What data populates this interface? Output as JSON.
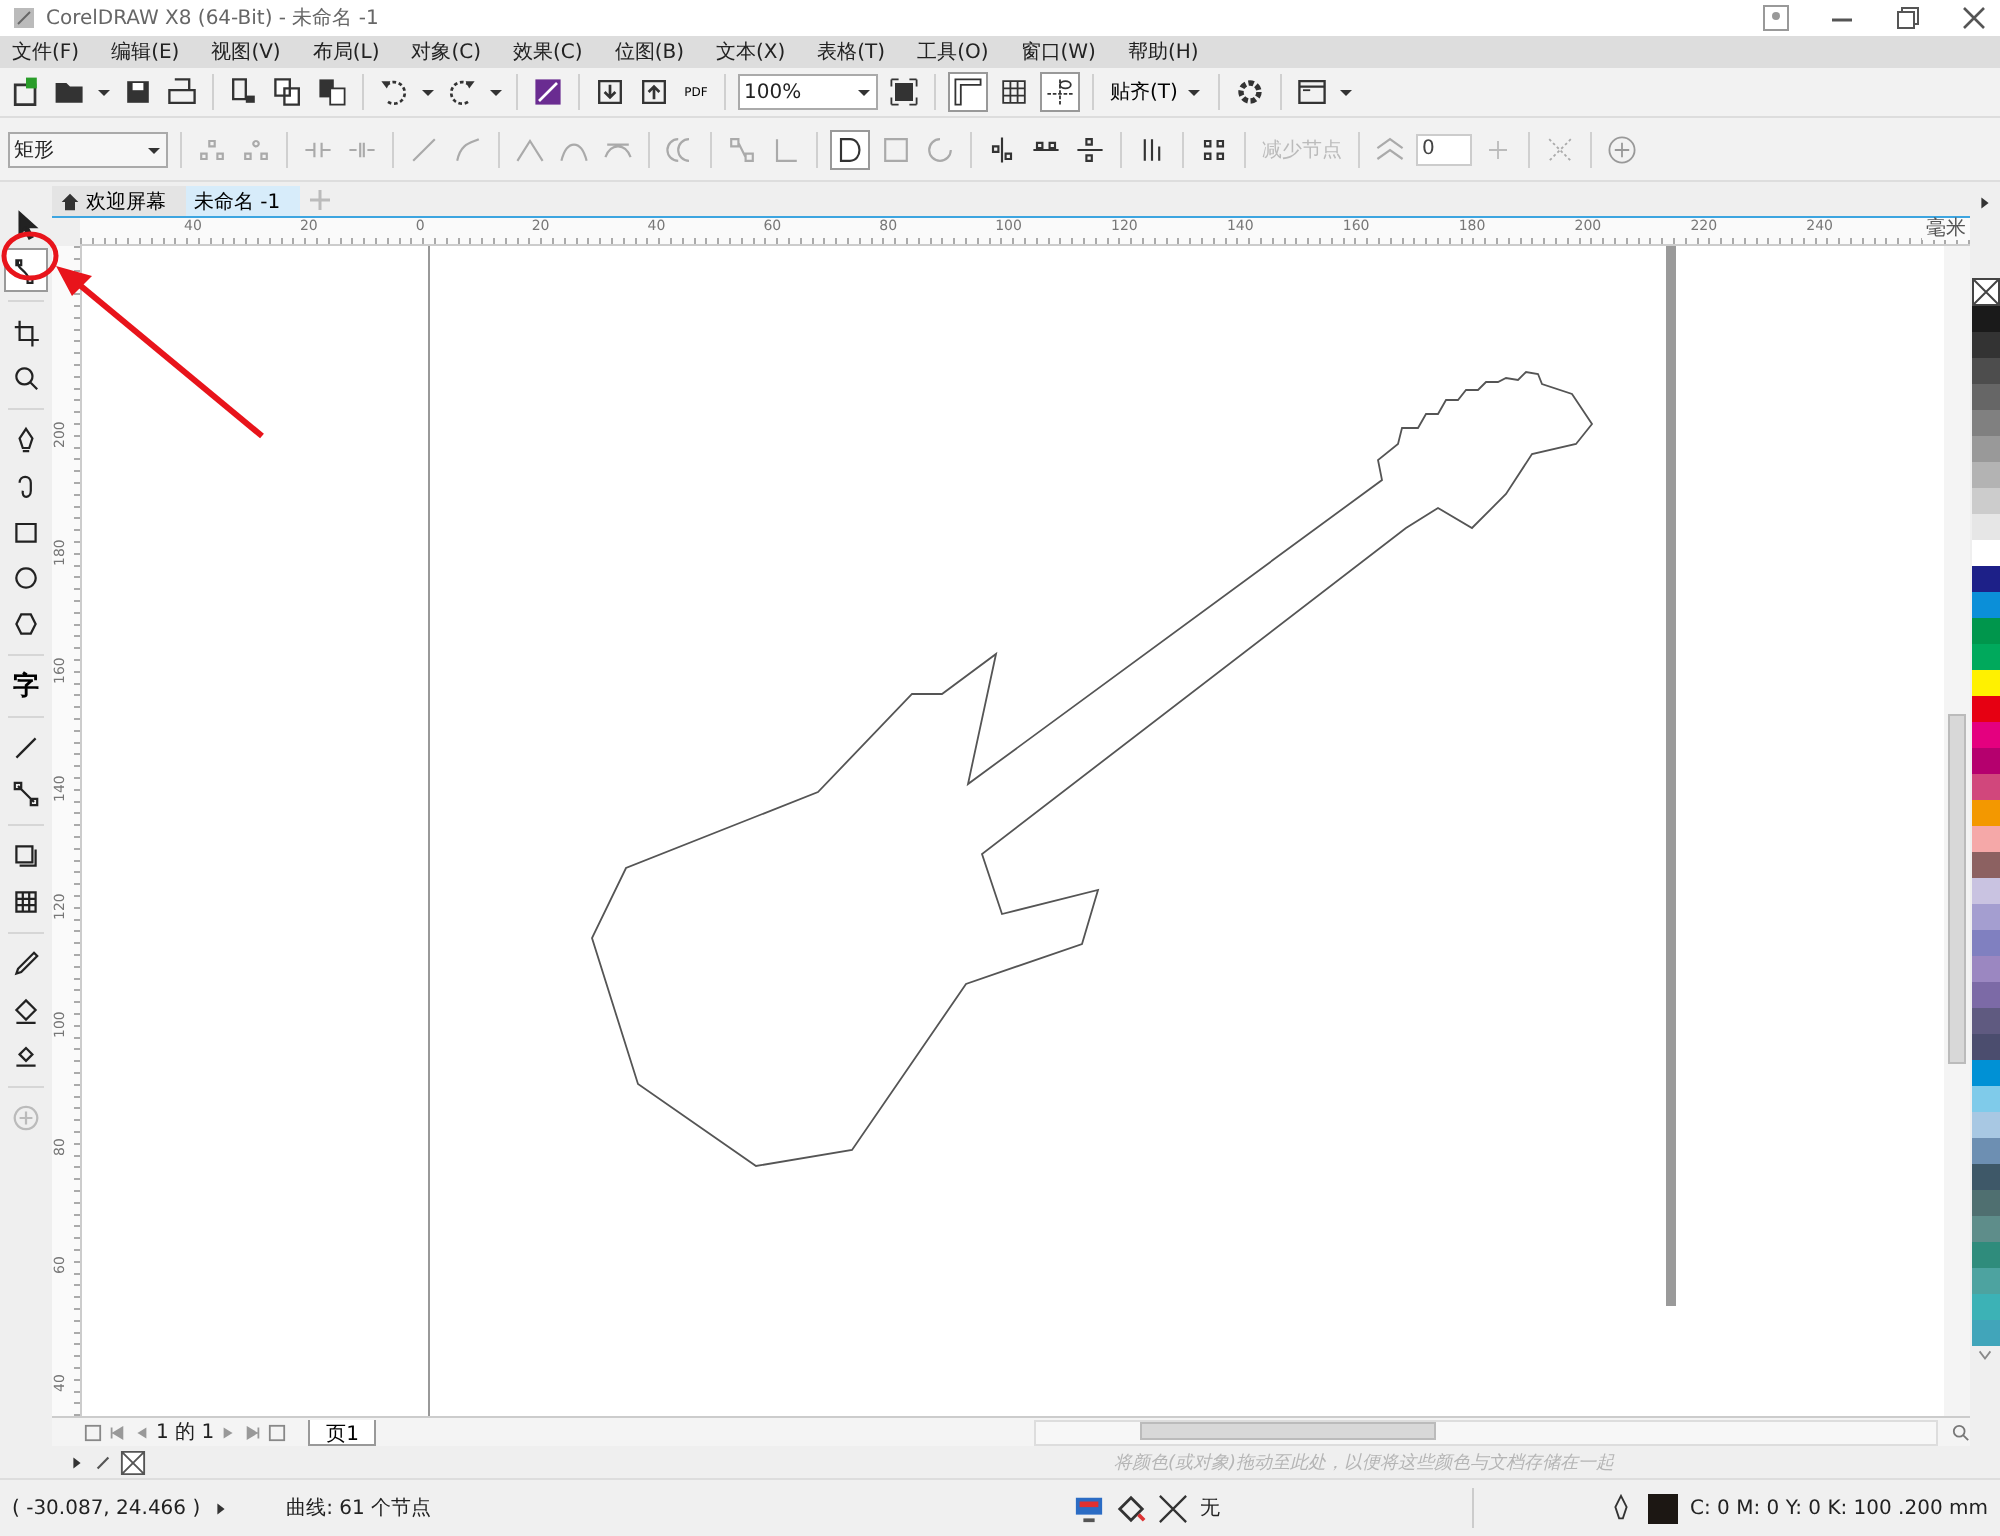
{
  "window": {
    "title": "CorelDRAW X8 (64-Bit) - 未命名 -1"
  },
  "menu": [
    "文件(F)",
    "编辑(E)",
    "视图(V)",
    "布局(L)",
    "对象(C)",
    "效果(C)",
    "位图(B)",
    "文本(X)",
    "表格(T)",
    "工具(O)",
    "窗口(W)",
    "帮助(H)"
  ],
  "standard_toolbar": {
    "pdf_label": "PDF",
    "zoom": "100%",
    "snap": "贴齐(T)"
  },
  "property_bar": {
    "shape_type": "矩形",
    "reduce_nodes": {
      "label": "减少节点",
      "disabled": true
    },
    "smoothness": "0"
  },
  "document_tabs": [
    {
      "label": "欢迎屏幕",
      "selected": false
    },
    {
      "label": "未命名 -1",
      "selected": true
    }
  ],
  "horizontal_ruler": {
    "labels": [
      "40",
      "20",
      "0",
      "20",
      "40",
      "60",
      "80",
      "100",
      "120",
      "140",
      "160",
      "180",
      "200",
      "220",
      "240"
    ],
    "unit": "毫米"
  },
  "vertical_ruler": {
    "labels": [
      "200",
      "180",
      "160",
      "140",
      "120",
      "100",
      "80",
      "60",
      "40"
    ]
  },
  "toolbox": [
    {
      "kind": "pointer",
      "selected": false
    },
    {
      "kind": "shape",
      "selected": true
    },
    {
      "kind": "crop",
      "selected": false
    },
    {
      "kind": "zoom",
      "selected": false
    },
    {
      "kind": "pen",
      "selected": false
    },
    {
      "kind": "artistic",
      "selected": false
    },
    {
      "kind": "rectangle",
      "selected": false
    },
    {
      "kind": "ellipse",
      "selected": false
    },
    {
      "kind": "polygon",
      "selected": false
    },
    {
      "kind": "text",
      "glyph": "字",
      "selected": false
    },
    {
      "kind": "line",
      "selected": false
    },
    {
      "kind": "connector",
      "selected": false
    },
    {
      "kind": "shadow",
      "selected": false
    },
    {
      "kind": "transparency",
      "selected": false
    },
    {
      "kind": "eyedropper",
      "selected": false
    },
    {
      "kind": "fill",
      "selected": false
    },
    {
      "kind": "smartfill",
      "selected": false
    },
    {
      "kind": "add",
      "selected": false
    }
  ],
  "page_navigator": {
    "position": "1 的 1",
    "page_tab": "页1"
  },
  "document_palette": {
    "hint": "将颜色(或对象)拖动至此处，以便将这些颜色与文档存储在一起"
  },
  "color_palette": [
    {
      "color": "#1a1a1a"
    },
    {
      "color": "#333333"
    },
    {
      "color": "#4d4d4d"
    },
    {
      "color": "#666666"
    },
    {
      "color": "#808080"
    },
    {
      "color": "#999999"
    },
    {
      "color": "#b3b3b3"
    },
    {
      "color": "#cccccc"
    },
    {
      "color": "#e6e6e6"
    },
    {
      "color": "#ffffff"
    },
    {
      "color": "#1d2088"
    },
    {
      "color": "#0b8fd8"
    },
    {
      "color": "#00964c"
    },
    {
      "color": "#00a95c"
    },
    {
      "color": "#fff100"
    },
    {
      "color": "#e60012"
    },
    {
      "color": "#e4007f"
    },
    {
      "color": "#b5006e"
    },
    {
      "color": "#d1477c"
    },
    {
      "color": "#f39800"
    },
    {
      "color": "#f5a8a8"
    },
    {
      "color": "#8c6161"
    },
    {
      "color": "#c9c3e1"
    },
    {
      "color": "#a49ed0"
    },
    {
      "color": "#8080c0"
    },
    {
      "color": "#9b87c1"
    },
    {
      "color": "#7c6aa6"
    },
    {
      "color": "#5f5a80"
    },
    {
      "color": "#4b4d6e"
    },
    {
      "color": "#0091d5"
    },
    {
      "color": "#7fcbea"
    },
    {
      "color": "#a8c8e3"
    },
    {
      "color": "#6d8fb2"
    },
    {
      "color": "#3e5868"
    },
    {
      "color": "#4f6f70"
    },
    {
      "color": "#5e8d8a"
    },
    {
      "color": "#2f8c7c"
    },
    {
      "color": "#4da3a0"
    },
    {
      "color": "#3cb2b6"
    },
    {
      "color": "#41a5ba"
    }
  ],
  "status_bar": {
    "coordinates": "( -30.087, 24.466 )",
    "selection": "曲线: 61 个节点",
    "fill": "无",
    "outline": "C: 0 M: 0 Y: 0 K: 100  .200 mm"
  }
}
